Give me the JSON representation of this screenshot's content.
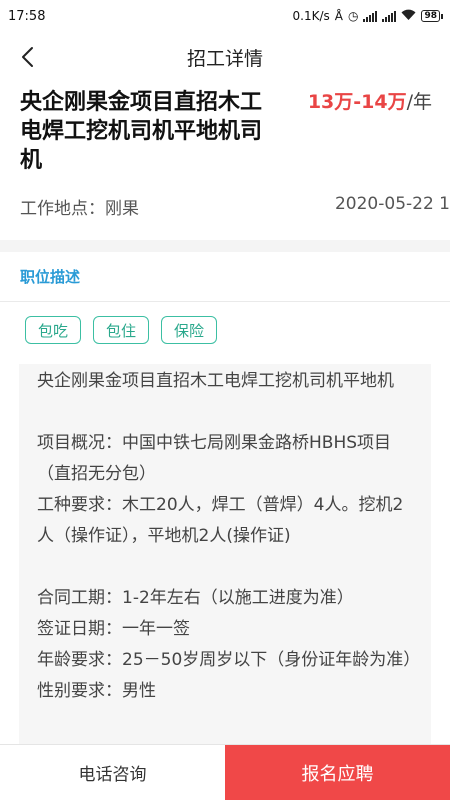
{
  "status_bar": {
    "time": "17:58",
    "speed": "0.1K/s",
    "battery": "98",
    "icons": [
      "bluetooth-icon",
      "alarm-icon",
      "signal-icon",
      "signal-icon",
      "wifi-icon",
      "battery-icon"
    ]
  },
  "nav": {
    "back_icon": "chevron-left-icon",
    "title": "招工详情"
  },
  "job": {
    "title": "央企刚果金项目直招木工电焊工挖机司机平地机司机",
    "salary": "13万-14万",
    "salary_unit": "/年",
    "location": "工作地点：刚果",
    "date": "2020-05-22 1"
  },
  "section": {
    "title": "职位描述"
  },
  "tags": [
    "包吃",
    "包住",
    "保险"
  ],
  "description": [
    "央企刚果金项目直招木工电焊工挖机司机平地机",
    "",
    "项目概况：中国中铁七局刚果金路桥HBHS项目（直招无分包）",
    "工种要求：木工20人，焊工（普焊）4人。挖机2人（操作证），平地机2人(操作证)",
    "",
    "合同工期：1-2年左右（以施工进度为准）",
    "签证日期：一年一签",
    "年龄要求：25－50岁周岁以下（身份证年龄为准）",
    "性别要求：男性"
  ],
  "bottom": {
    "call_label": "电话咨询",
    "apply_label": "报名应聘"
  },
  "colors": {
    "accent_blue": "#2a9bd6",
    "salary_red": "#e94545",
    "tag_green": "#3cbfa3",
    "apply_red": "#f04848"
  }
}
